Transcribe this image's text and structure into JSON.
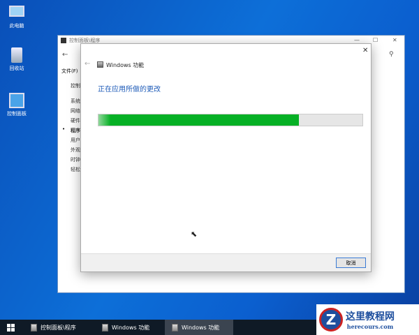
{
  "desktop": {
    "icons": [
      "此电脑",
      "回收站",
      "控制面板"
    ]
  },
  "back_window": {
    "title": "控制面板\\程序",
    "menu_file": "文件(F)",
    "sidebar": [
      "控制",
      "系统",
      "网络",
      "硬件",
      "程序",
      "用户",
      "外观",
      "时钟",
      "轻松"
    ]
  },
  "dialog": {
    "title": "Windows 功能",
    "heading": "正在应用所做的更改",
    "progress_percent": 76,
    "cancel_label": "取消"
  },
  "taskbar": {
    "items": [
      "控制面板\\程序",
      "Windows 功能",
      "Windows 功能"
    ]
  },
  "watermark": {
    "title": "这里教程网",
    "url": "herecours.com"
  },
  "colors": {
    "accent": "#1e5bb8",
    "progress": "#06b025"
  }
}
